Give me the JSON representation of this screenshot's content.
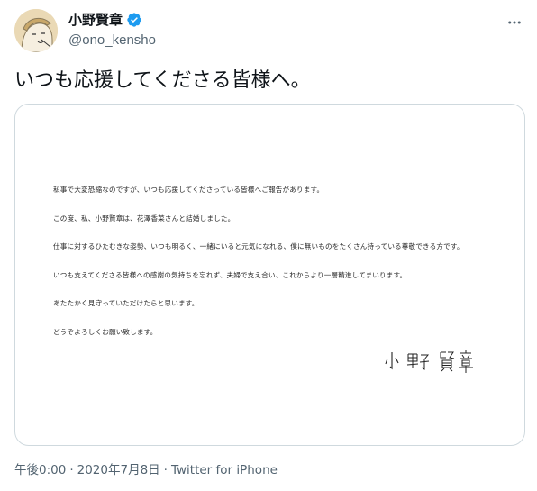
{
  "author": {
    "display_name": "小野賢章",
    "handle": "@ono_kensho",
    "verified_icon": "verified-badge-icon",
    "avatar_icon": "avatar-illustration"
  },
  "more_icon": "ellipsis-icon",
  "tweet": {
    "text": "いつも応援してくださる皆様へ。"
  },
  "letter": {
    "paragraphs": [
      "私事で大変恐縮なのですが、いつも応援してくださっている皆様へご報告があります。",
      "この度、私、小野賢章は、花澤香菜さんと結婚しました。",
      "仕事に対するひたむきな姿勢、いつも明るく、一緒にいると元気になれる、僕に無いものをたくさん持っている尊敬できる方です。",
      "いつも支えてくださる皆様への感謝の気持ちを忘れず、夫婦で支え合い、これからより一層精進してまいります。",
      "あたたかく見守っていただけたらと思います。",
      "どうぞよろしくお願い致します。"
    ],
    "signature": "小野賢章"
  },
  "meta": {
    "time": "午後0:00",
    "separator": "·",
    "date": "2020年7月8日",
    "source": "Twitter for iPhone"
  },
  "colors": {
    "verified_blue": "#1d9bf0",
    "secondary_text": "#536471",
    "border": "#cfd9de",
    "avatar_bg": "#ead9b5"
  }
}
